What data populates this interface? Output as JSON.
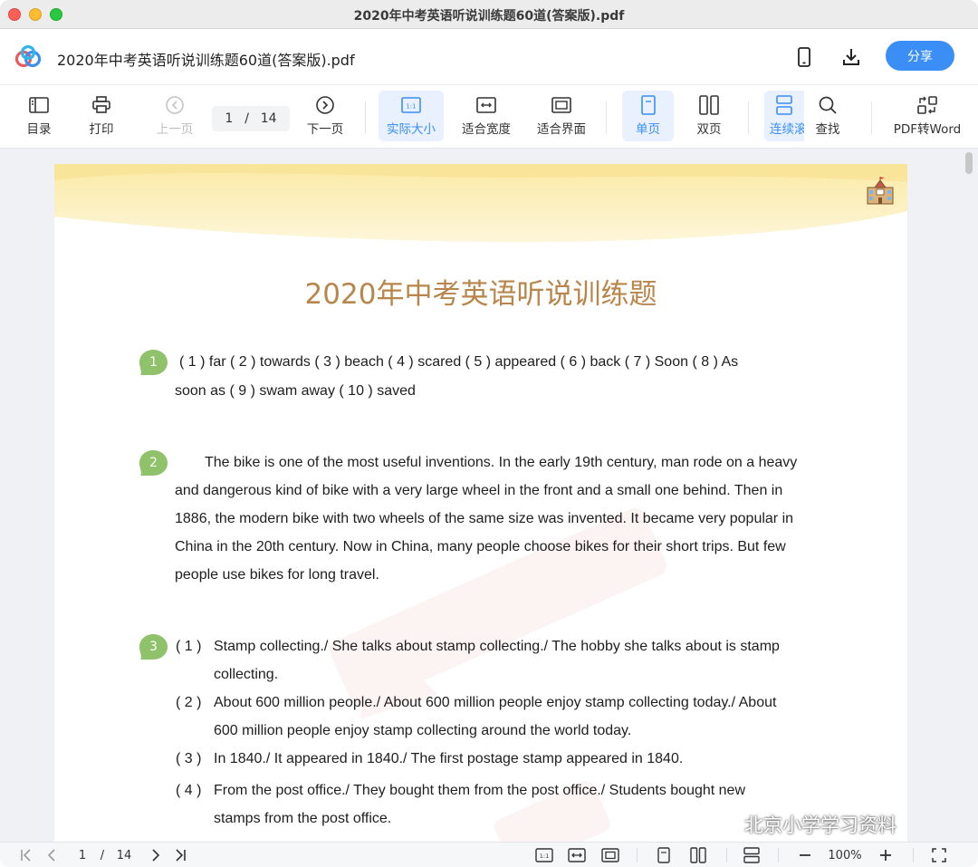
{
  "window": {
    "title": "2020年中考英语听说训练题60道(答案版).pdf"
  },
  "header": {
    "doc_title": "2020年中考英语听说训练题60道(答案版).pdf",
    "share_label": "分享"
  },
  "toolbar": {
    "toc": "目录",
    "print": "打印",
    "prev": "上一页",
    "page_current": "1",
    "page_sep": "/",
    "page_total": "14",
    "next": "下一页",
    "actual_size": "实际大小",
    "fit_width": "适合宽度",
    "fit_page": "适合界面",
    "single": "单页",
    "double": "双页",
    "continuous": "连续滚",
    "find": "查找",
    "pdf_to_word": "PDF转Word"
  },
  "document": {
    "title": "2020年中考英语听说训练题",
    "q1": {
      "num": "1",
      "line1": "( 1 ) far ( 2 ) towards ( 3 ) beach ( 4 ) scared ( 5 ) appeared ( 6 ) back ( 7 ) Soon ( 8 ) As",
      "line2": "soon as ( 9 ) swam away ( 10 ) saved"
    },
    "q2": {
      "num": "2",
      "lines": [
        "The bike is one of the most useful inventions. In the early 19th century, man rode on a heavy",
        "and dangerous kind of bike with a very large wheel in the front and a small one behind. Then in",
        "1886, the modern bike with two wheels of the same size was invented. It became very popular in",
        "China in the 20th century. Now in China, many people choose bikes for their short trips. But few",
        "people use bikes for long travel."
      ]
    },
    "q3": {
      "num": "3",
      "items": [
        {
          "num": "( 1 )",
          "line1": "Stamp collecting./ She talks about stamp collecting./ The hobby she talks about is stamp",
          "line2": "collecting."
        },
        {
          "num": "( 2 )",
          "line1": "About 600 million people./ About 600 million people enjoy stamp collecting today./ About",
          "line2": "600 million people enjoy stamp collecting around the world today."
        },
        {
          "num": "( 3 )",
          "line1": "In 1840./ It appeared in 1840./ The first postage stamp appeared in 1840.",
          "line2": ""
        },
        {
          "num": "( 4 )",
          "line1": "From the post office./ They bought them from the post office./ Students bought new",
          "line2": "stamps from the post office."
        }
      ]
    }
  },
  "statusbar": {
    "page_current": "1",
    "page_sep": "/",
    "page_total": "14",
    "zoom": "100%"
  },
  "overlay": {
    "wechat_watermark": "北京小学学习资料"
  },
  "colors": {
    "accent": "#3a8ef6",
    "title_gold": "#b8864a",
    "badge_green": "#8fc26a",
    "banner_yellow": "#fdf3c8"
  }
}
